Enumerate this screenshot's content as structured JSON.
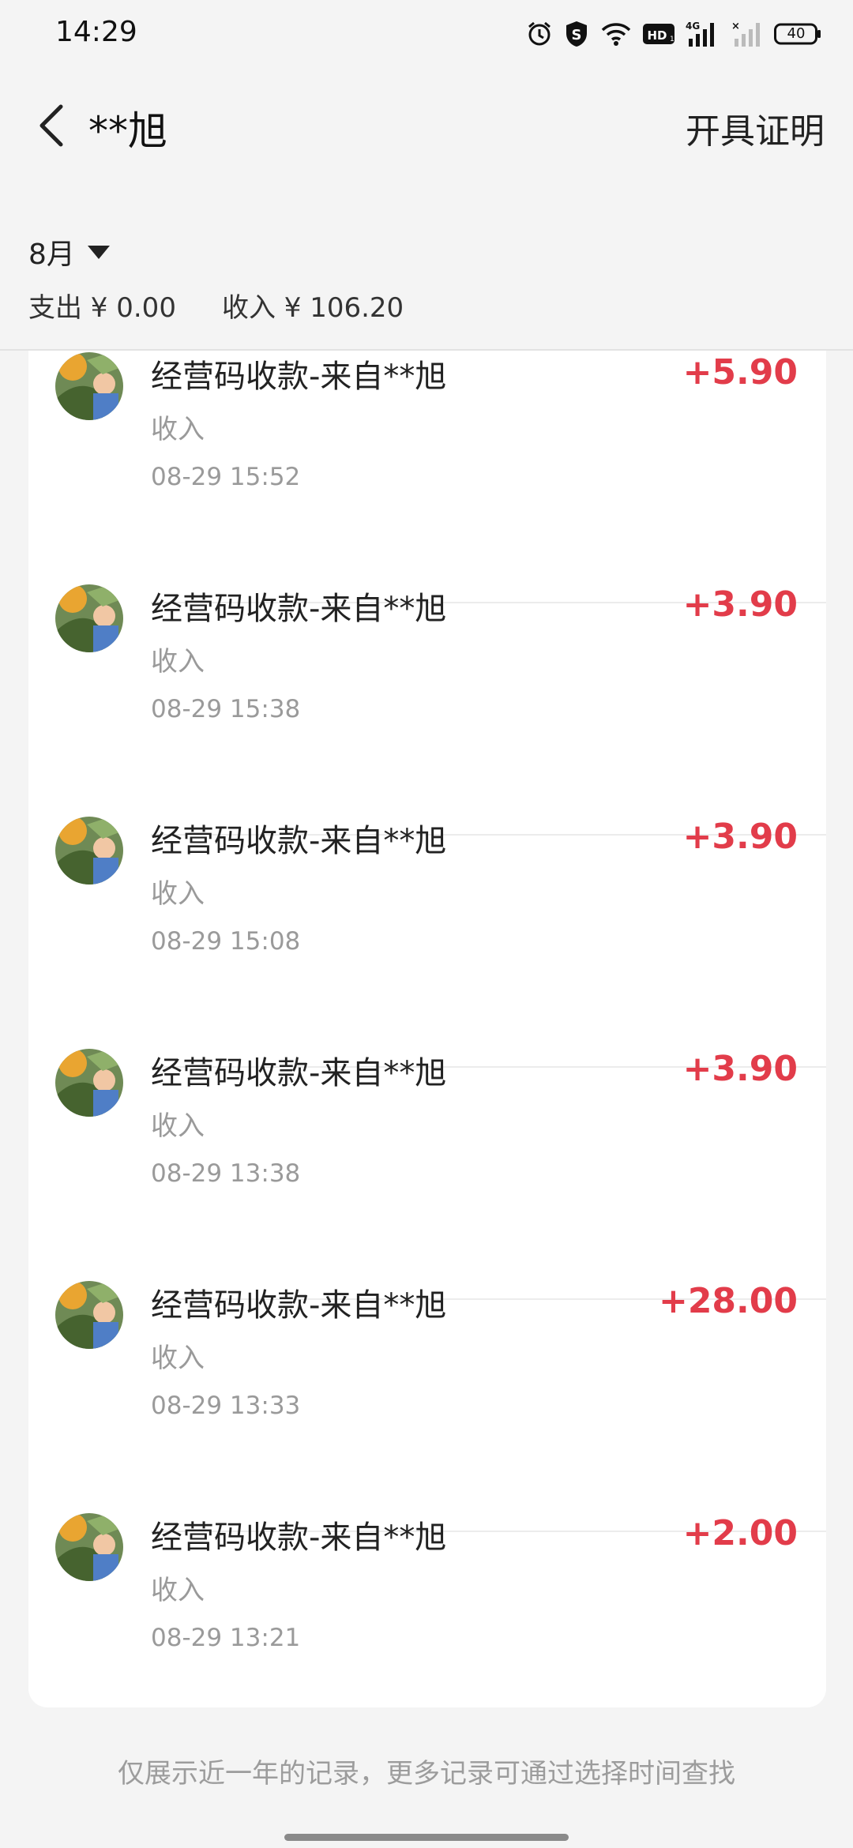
{
  "status_bar": {
    "time": "14:29",
    "battery": "40"
  },
  "nav": {
    "title": "**旭",
    "action": "开具证明"
  },
  "summary": {
    "month": "8月",
    "expense": "支出 ¥ 0.00",
    "income": "收入 ¥ 106.20"
  },
  "transactions": [
    {
      "title": "经营码收款-来自**旭",
      "type": "收入",
      "time": "08-29 15:52",
      "amount": "+5.90"
    },
    {
      "title": "经营码收款-来自**旭",
      "type": "收入",
      "time": "08-29 15:38",
      "amount": "+3.90"
    },
    {
      "title": "经营码收款-来自**旭",
      "type": "收入",
      "time": "08-29 15:08",
      "amount": "+3.90"
    },
    {
      "title": "经营码收款-来自**旭",
      "type": "收入",
      "time": "08-29 13:38",
      "amount": "+3.90"
    },
    {
      "title": "经营码收款-来自**旭",
      "type": "收入",
      "time": "08-29 13:33",
      "amount": "+28.00"
    },
    {
      "title": "经营码收款-来自**旭",
      "type": "收入",
      "time": "08-29 13:21",
      "amount": "+2.00"
    }
  ],
  "footer": {
    "note": "仅展示近一年的记录，更多记录可通过选择时间查找"
  },
  "colors": {
    "amount": "#e23c4a",
    "background": "#f4f4f4",
    "card": "#ffffff"
  },
  "icons": [
    "alarm-icon",
    "shield-s-icon",
    "wifi-icon",
    "hd-icon",
    "signal-4g-icon",
    "signal-empty-icon",
    "battery-icon",
    "back-arrow-icon",
    "dropdown-triangle-icon",
    "avatar"
  ]
}
